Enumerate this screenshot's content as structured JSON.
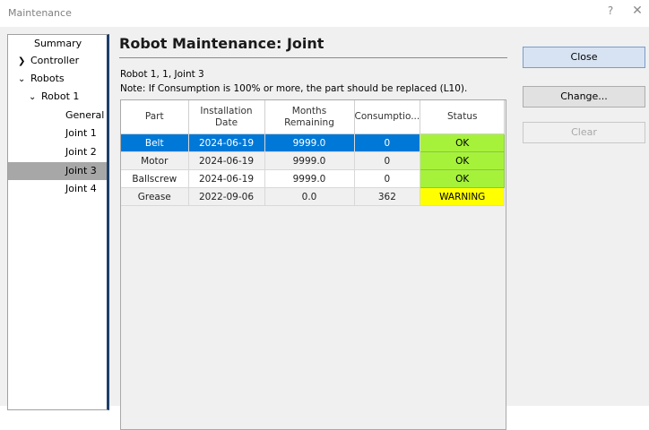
{
  "window": {
    "title": "Maintenance",
    "help": "?",
    "close": "✕"
  },
  "tree": {
    "items": [
      {
        "label": "Summary",
        "chevron": ""
      },
      {
        "label": "Controller",
        "chevron": "❯"
      },
      {
        "label": "Robots",
        "chevron": "⌄"
      },
      {
        "label": "Robot 1",
        "chevron": "⌄"
      },
      {
        "label": "General",
        "chevron": ""
      },
      {
        "label": "Joint 1",
        "chevron": ""
      },
      {
        "label": "Joint 2",
        "chevron": ""
      },
      {
        "label": "Joint 3",
        "chevron": ""
      },
      {
        "label": "Joint 4",
        "chevron": ""
      }
    ]
  },
  "main": {
    "title": "Robot Maintenance: Joint",
    "info_line1": "Robot 1, 1, Joint 3",
    "info_line2": "Note: If Consumption is 100% or more, the part should be replaced (L10)."
  },
  "table": {
    "headers": {
      "part": "Part",
      "install_1": "Installation",
      "install_2": "Date",
      "months_1": "Months",
      "months_2": "Remaining",
      "consumption": "Consumptio...",
      "status": "Status"
    },
    "rows": [
      {
        "part": "Belt",
        "date": "2024-06-19",
        "months": "9999.0",
        "consumption": "0",
        "status": "OK"
      },
      {
        "part": "Motor",
        "date": "2024-06-19",
        "months": "9999.0",
        "consumption": "0",
        "status": "OK"
      },
      {
        "part": "Ballscrew",
        "date": "2024-06-19",
        "months": "9999.0",
        "consumption": "0",
        "status": "OK"
      },
      {
        "part": "Grease",
        "date": "2022-09-06",
        "months": "0.0",
        "consumption": "362",
        "status": "WARNING"
      }
    ]
  },
  "buttons": {
    "close": "Close",
    "change": "Change...",
    "clear": "Clear"
  },
  "colors": {
    "selection": "#0078d7",
    "ok": "#a6f23a",
    "warning": "#ffff00",
    "tree_selected": "#a7a7a7"
  }
}
